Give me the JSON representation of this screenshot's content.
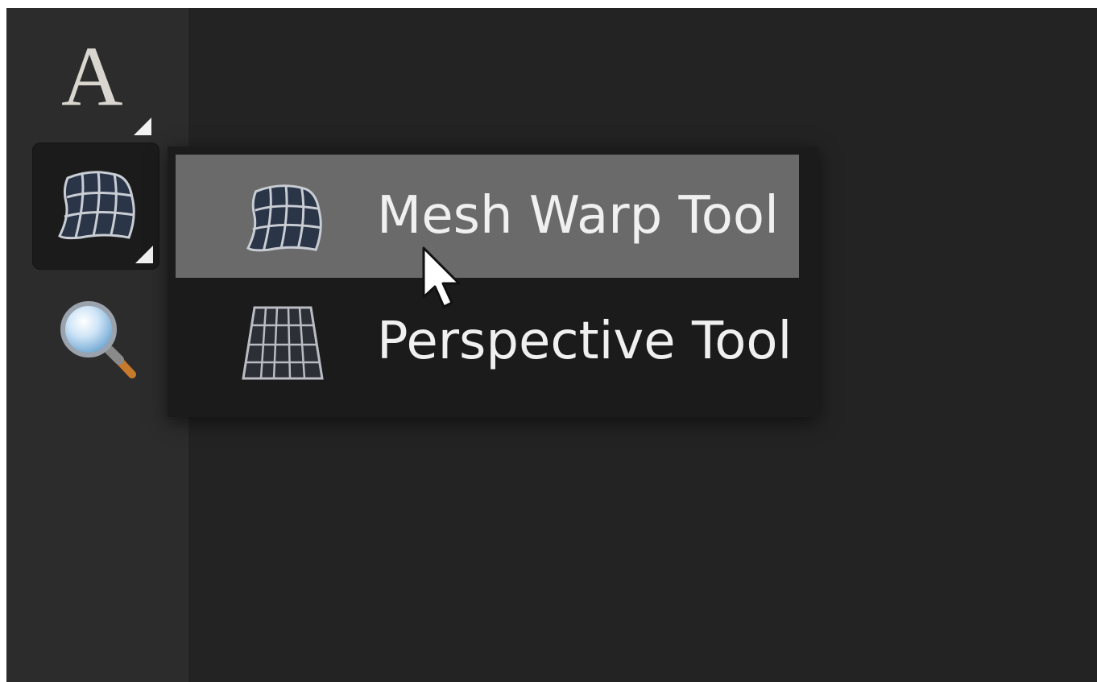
{
  "toolbar": {
    "text_tool": {
      "glyph": "A",
      "icon": "text-tool-icon"
    },
    "mesh_warp_tool": {
      "icon": "mesh-warp-icon",
      "selected": true
    },
    "zoom_tool": {
      "icon": "magnifier-icon"
    }
  },
  "flyout": {
    "items": [
      {
        "label": "Mesh Warp Tool",
        "icon": "mesh-warp-icon",
        "highlighted": true
      },
      {
        "label": "Perspective Tool",
        "icon": "perspective-grid-icon",
        "highlighted": false
      }
    ]
  },
  "colors": {
    "canvas_bg": "#232323",
    "toolbar_bg": "#2c2c2c",
    "menu_bg": "#1b1b1b",
    "menu_highlight": "#6a6a6a",
    "text": "#f0f0f0"
  }
}
